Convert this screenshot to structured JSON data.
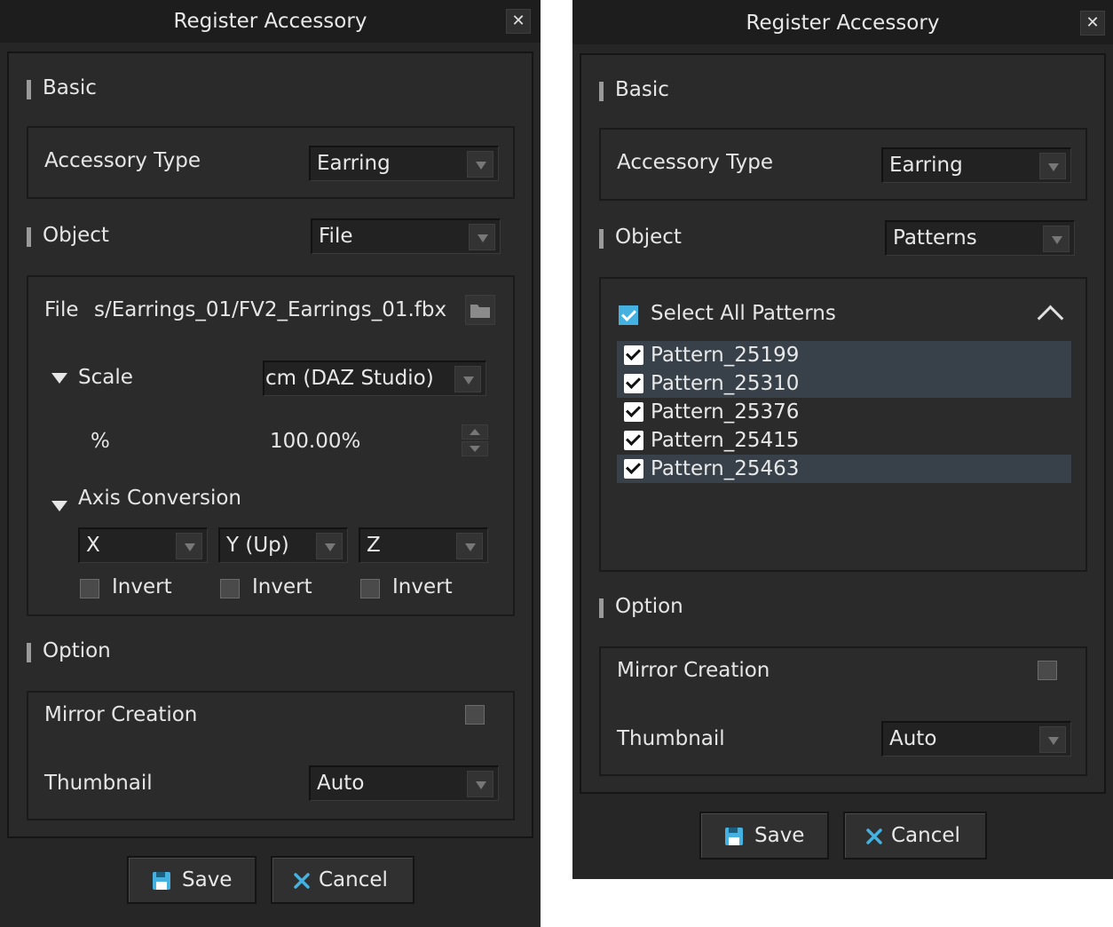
{
  "dialog_left": {
    "title": "Register Accessory",
    "close": "✕",
    "basic": {
      "section_label": "Basic",
      "accessory_type_label": "Accessory Type",
      "accessory_type_value": "Earring"
    },
    "object": {
      "section_label": "Object",
      "source_value": "File",
      "file_label": "File",
      "file_path": "s/Earrings_01/FV2_Earrings_01.fbx",
      "scale_label": "Scale",
      "scale_unit": "cm (DAZ Studio)",
      "percent_label": "%",
      "percent_value": "100.00%",
      "axis_label": "Axis Conversion",
      "axes": [
        {
          "value": "X",
          "invert_label": "Invert",
          "invert_checked": false
        },
        {
          "value": "Y (Up)",
          "invert_label": "Invert",
          "invert_checked": false
        },
        {
          "value": "Z",
          "invert_label": "Invert",
          "invert_checked": false
        }
      ]
    },
    "option": {
      "section_label": "Option",
      "mirror_label": "Mirror Creation",
      "mirror_checked": false,
      "thumbnail_label": "Thumbnail",
      "thumbnail_value": "Auto"
    },
    "buttons": {
      "save": "Save",
      "cancel": "Cancel"
    }
  },
  "dialog_right": {
    "title": "Register Accessory",
    "close": "✕",
    "basic": {
      "section_label": "Basic",
      "accessory_type_label": "Accessory Type",
      "accessory_type_value": "Earring"
    },
    "object": {
      "section_label": "Object",
      "source_value": "Patterns",
      "select_all_label": "Select All Patterns",
      "select_all_checked": true,
      "patterns": [
        {
          "name": "Pattern_25199",
          "checked": true,
          "highlighted": true
        },
        {
          "name": "Pattern_25310",
          "checked": true,
          "highlighted": true
        },
        {
          "name": "Pattern_25376",
          "checked": true,
          "highlighted": false
        },
        {
          "name": "Pattern_25415",
          "checked": true,
          "highlighted": false
        },
        {
          "name": "Pattern_25463",
          "checked": true,
          "highlighted": true
        }
      ]
    },
    "option": {
      "section_label": "Option",
      "mirror_label": "Mirror Creation",
      "mirror_checked": false,
      "thumbnail_label": "Thumbnail",
      "thumbnail_value": "Auto"
    },
    "buttons": {
      "save": "Save",
      "cancel": "Cancel"
    }
  },
  "colors": {
    "accent": "#45b1e0",
    "row_highlight": "#384049",
    "background": "#262626"
  }
}
